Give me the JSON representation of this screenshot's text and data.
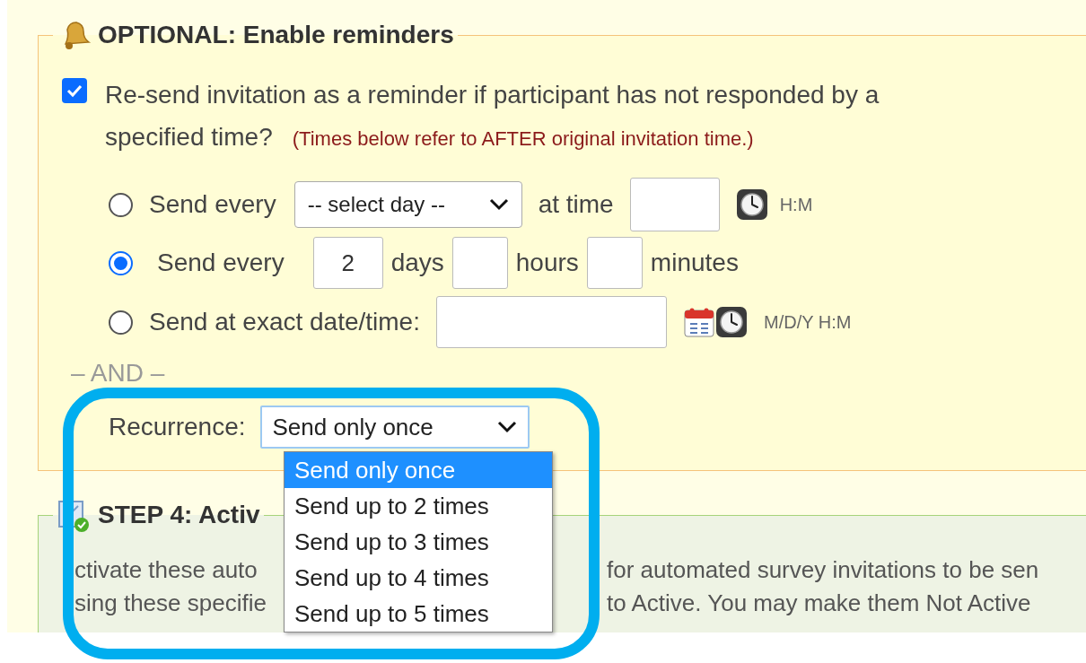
{
  "reminders": {
    "legend": "OPTIONAL: Enable reminders",
    "enable": {
      "checked": true,
      "label": "Re-send invitation as a reminder if participant has not responded by a specified time?",
      "note": "(Times below refer to AFTER original invitation time.)"
    },
    "options": [
      {
        "kind": "weekday",
        "selected": false,
        "label": "Send every",
        "select_value": "-- select day --",
        "at_label": "at time",
        "format": "H:M"
      },
      {
        "kind": "interval",
        "selected": true,
        "label": "Send every",
        "days": "2",
        "days_label": "days",
        "hours_label": "hours",
        "minutes_label": "minutes"
      },
      {
        "kind": "exact",
        "selected": false,
        "label": "Send at exact date/time:",
        "format": "M/D/Y H:M"
      }
    ],
    "separator": "– AND –",
    "recurrence": {
      "label": "Recurrence:",
      "value": "Send only once",
      "expanded": true,
      "options": [
        {
          "label": "Send only once",
          "selected": true
        },
        {
          "label": "Send up to 2 times",
          "selected": false
        },
        {
          "label": "Send up to 3 times",
          "selected": false
        },
        {
          "label": "Send up to 4 times",
          "selected": false
        },
        {
          "label": "Send up to 5 times",
          "selected": false
        }
      ]
    }
  },
  "step4": {
    "title": "STEP 4: Activ",
    "lines": [
      {
        "left": "ctivate these auto",
        "right": "for automated survey invitations to be sen"
      },
      {
        "left": "sing these specifie",
        "right": "to Active. You may make them Not Active"
      }
    ]
  }
}
